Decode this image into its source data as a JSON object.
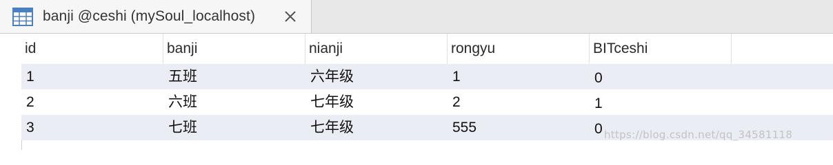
{
  "tab": {
    "title": "banji @ceshi (mySoul_localhost)",
    "icon": "table-icon",
    "close_icon": "close-icon"
  },
  "table": {
    "columns": [
      "id",
      "banji",
      "nianji",
      "rongyu",
      "BITceshi"
    ],
    "rows": [
      [
        "1",
        "五班",
        "六年级",
        "1",
        "0"
      ],
      [
        "2",
        "六班",
        "七年级",
        "2",
        "1"
      ],
      [
        "3",
        "七班",
        "七年级",
        "555",
        "0"
      ]
    ]
  },
  "watermark": "https://blog.csdn.net/qq_34581118",
  "colors": {
    "stripe": "#ebedf5",
    "tab_active": "#f6f6f6",
    "tabbar": "#e8e8e8",
    "icon_blue": "#4a7fc1"
  }
}
